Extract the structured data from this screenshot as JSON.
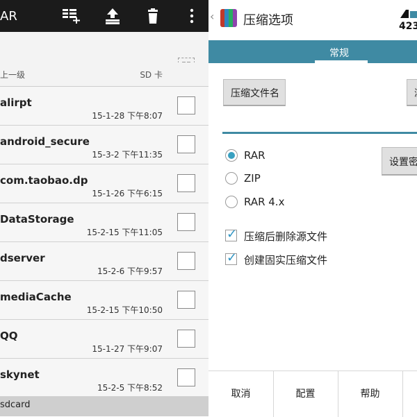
{
  "left_panel": {
    "title": "AR",
    "crumb_up": "上一级",
    "crumb_storage": "SD 卡",
    "files": [
      {
        "name": "alirpt",
        "date": "15-1-28 下午8:07"
      },
      {
        "name": "android_secure",
        "date": "15-3-2 下午11:35"
      },
      {
        "name": "com.taobao.dp",
        "date": "15-1-26 下午6:15"
      },
      {
        "name": "DataStorage",
        "date": "15-2-15 下午11:05"
      },
      {
        "name": "dserver",
        "date": "15-2-6 下午9:57"
      },
      {
        "name": "mediaCache",
        "date": "15-2-15 下午10:50"
      },
      {
        "name": "QQ",
        "date": "15-1-27 下午9:07"
      },
      {
        "name": "skynet",
        "date": "15-2-5 下午8:52"
      }
    ],
    "footer_path": "sdcard"
  },
  "right_panel": {
    "title": "压缩选项",
    "logo_text": "423",
    "tab_general": "常规",
    "archive_name_button": "压缩文件名",
    "browse_button_partial": "浏",
    "set_password_button_partial": "设置密",
    "formats": [
      "RAR",
      "ZIP",
      "RAR 4.x"
    ],
    "selected_format": "RAR",
    "options": [
      {
        "label": "压缩后删除源文件",
        "checked": true
      },
      {
        "label": "创建固实压缩文件",
        "checked": true
      }
    ],
    "bottom_buttons": [
      "取消",
      "配置",
      "帮助"
    ]
  },
  "colors": {
    "accent": "#3f8aa3",
    "titlebar_dark": "#1b1b1b",
    "radio_selected": "#39a0c0"
  }
}
